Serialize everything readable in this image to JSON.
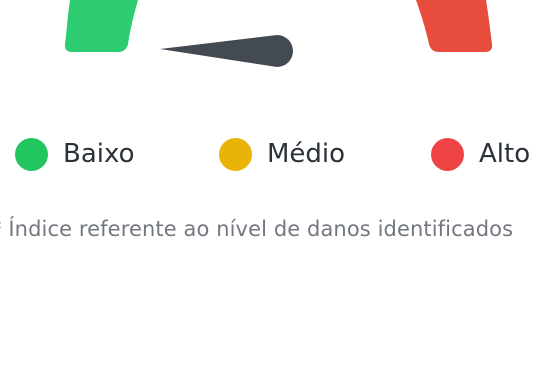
{
  "gauge": {
    "segments": [
      {
        "name": "low",
        "color": "#2ecc71"
      },
      {
        "name": "high",
        "color": "#e74c3c"
      }
    ],
    "needle_color": "#444a51"
  },
  "legend": {
    "items": [
      {
        "label": "Baixo",
        "color": "#22c55e"
      },
      {
        "label": "Médio",
        "color": "#eab308"
      },
      {
        "label": "Alto",
        "color": "#ef4444"
      }
    ]
  },
  "footnote": {
    "text": "* Índice referente ao nível de danos identificados"
  }
}
